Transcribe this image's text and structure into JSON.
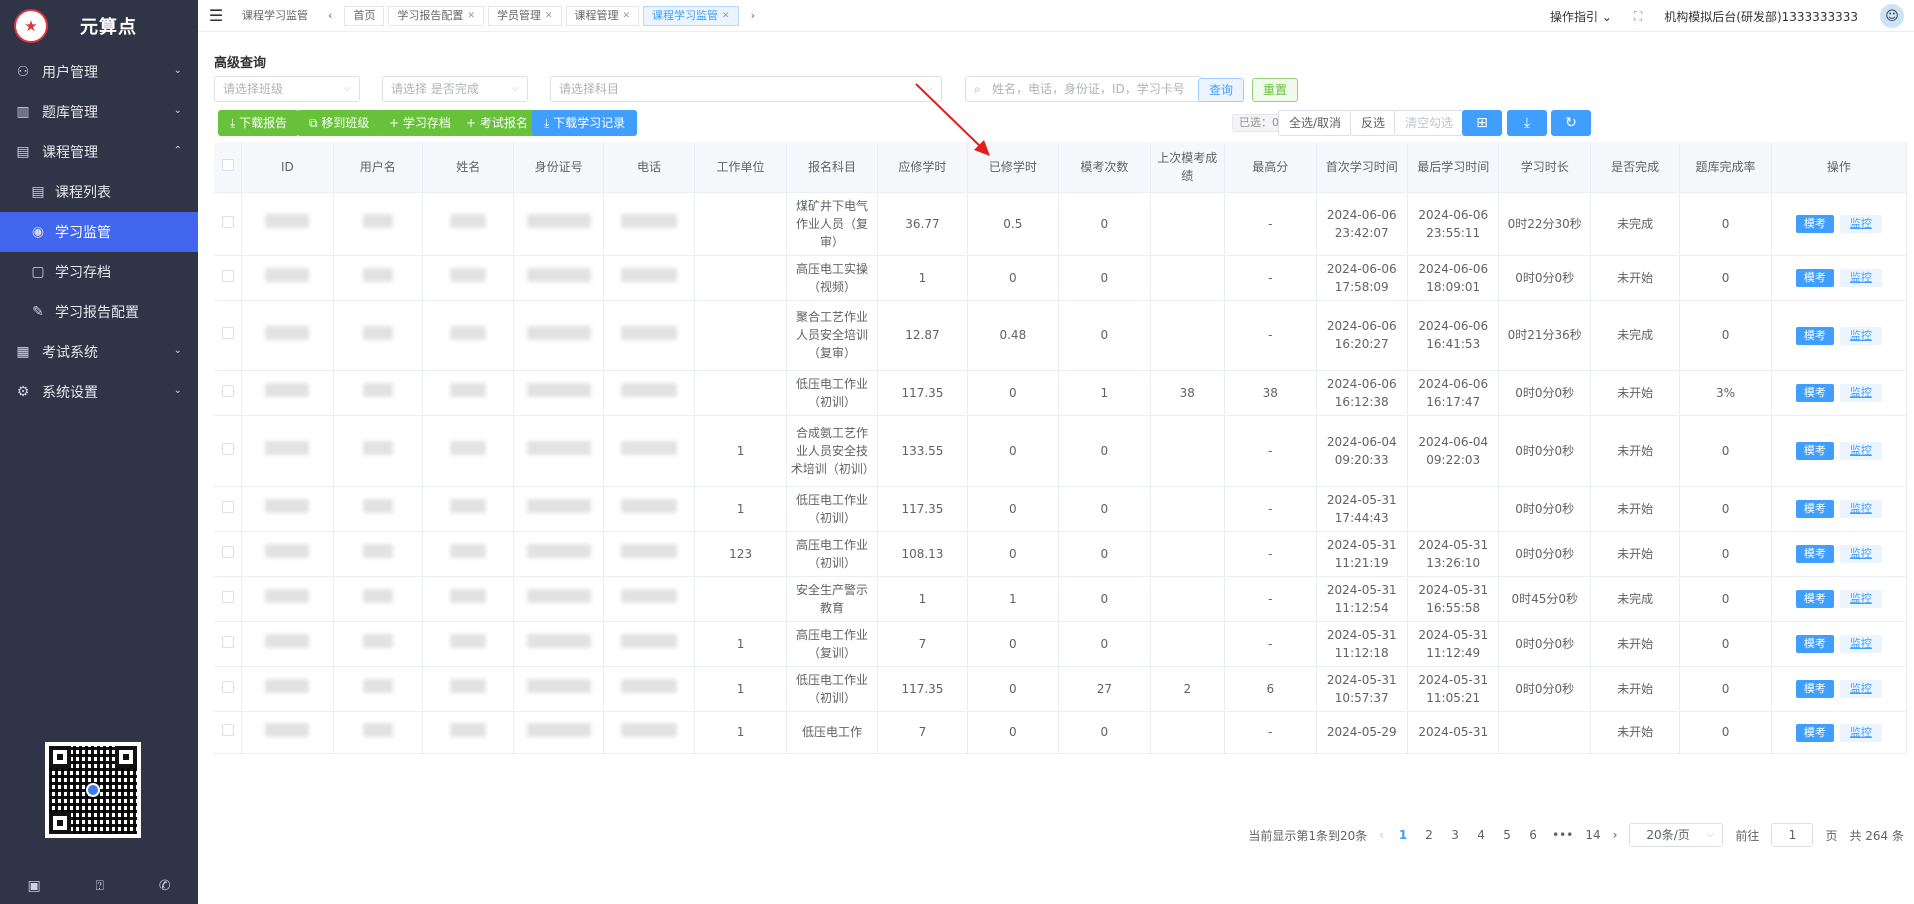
{
  "brand": {
    "name": "元算点",
    "logo_icon": "seal-logo-icon"
  },
  "sidebar": {
    "items": [
      {
        "label": "用户管理",
        "icon": "users-icon",
        "expanded": false
      },
      {
        "label": "题库管理",
        "icon": "library-icon",
        "expanded": false
      },
      {
        "label": "课程管理",
        "icon": "book-icon",
        "expanded": true
      },
      {
        "label": "考试系统",
        "icon": "exam-icon",
        "expanded": false
      },
      {
        "label": "系统设置",
        "icon": "gear-icon",
        "expanded": false
      }
    ],
    "sub_items": [
      {
        "label": "课程列表",
        "icon": "list-icon"
      },
      {
        "label": "学习监管",
        "icon": "eye-icon",
        "active": true
      },
      {
        "label": "学习存档",
        "icon": "file-icon"
      },
      {
        "label": "学习报告配置",
        "icon": "edit-icon"
      }
    ]
  },
  "topbar": {
    "tabs": [
      {
        "label": "课程学习监管",
        "closable": false,
        "plain": true
      },
      {
        "label": "首页",
        "closable": false
      },
      {
        "label": "学习报告配置",
        "closable": true
      },
      {
        "label": "学员管理",
        "closable": true
      },
      {
        "label": "课程管理",
        "closable": true
      },
      {
        "label": "课程学习监管",
        "closable": true,
        "active": true
      }
    ],
    "guide": "操作指引",
    "user": "机构模拟后台(研发部)1333333333"
  },
  "filters": {
    "title": "高级查询",
    "class_placeholder": "请选择班级",
    "done_placeholder": "请选择 是否完成",
    "subject_placeholder": "请选择科目",
    "search_placeholder": "姓名，电话，身份证，ID，学习卡号",
    "query_label": "查询",
    "reset_label": "重置"
  },
  "toolbar": {
    "download_report": "下载报告",
    "move_class": "移到班级",
    "archive": "学习存档",
    "exam_signup": "考试报名",
    "download_record": "下载学习记录",
    "selected": "已选：0",
    "select_all": "全选/取消",
    "invert": "反选",
    "clear": "清空勾选"
  },
  "table": {
    "headers": [
      "ID",
      "用户名",
      "姓名",
      "身份证号",
      "电话",
      "工作单位",
      "报名科目",
      "应修学时",
      "已修学时",
      "模考次数",
      "上次模考成绩",
      "最高分",
      "首次学习时间",
      "最后学习时间",
      "学习时长",
      "是否完成",
      "题库完成率",
      "操作"
    ],
    "op_primary": "模考",
    "op_link": "监控",
    "rows": [
      {
        "unit": "",
        "subject": "煤矿井下电气作业人员（复审）",
        "req": "36.77",
        "done": "0.5",
        "mock": "0",
        "last": "",
        "best": "-",
        "first": "2024-06-06 23:42:07",
        "lastStudy": "2024-06-06 23:55:11",
        "dur": "0时22分30秒",
        "status": "未完成",
        "rate": "0",
        "h": 56
      },
      {
        "unit": "",
        "subject": "高压电工实操（视频）",
        "req": "1",
        "done": "0",
        "mock": "0",
        "last": "",
        "best": "-",
        "first": "2024-06-06 17:58:09",
        "lastStudy": "2024-06-06 18:09:01",
        "dur": "0时0分0秒",
        "status": "未开始",
        "rate": "0",
        "h": 42
      },
      {
        "unit": "",
        "subject": "聚合工艺作业人员安全培训（复审）",
        "req": "12.87",
        "done": "0.48",
        "mock": "0",
        "last": "",
        "best": "-",
        "first": "2024-06-06 16:20:27",
        "lastStudy": "2024-06-06 16:41:53",
        "dur": "0时21分36秒",
        "status": "未完成",
        "rate": "0",
        "h": 70
      },
      {
        "unit": "",
        "subject": "低压电工作业（初训）",
        "req": "117.35",
        "done": "0",
        "mock": "1",
        "last": "38",
        "best": "38",
        "first": "2024-06-06 16:12:38",
        "lastStudy": "2024-06-06 16:17:47",
        "dur": "0时0分0秒",
        "status": "未开始",
        "rate": "3%",
        "h": 42
      },
      {
        "unit": "1",
        "subject": "合成氨工艺作业人员安全技术培训（初训）",
        "req": "133.55",
        "done": "0",
        "mock": "0",
        "last": "",
        "best": "-",
        "first": "2024-06-04 09:20:33",
        "lastStudy": "2024-06-04 09:22:03",
        "dur": "0时0分0秒",
        "status": "未开始",
        "rate": "0",
        "h": 71
      },
      {
        "unit": "1",
        "subject": "低压电工作业（初训）",
        "req": "117.35",
        "done": "0",
        "mock": "0",
        "last": "",
        "best": "-",
        "first": "2024-05-31 17:44:43",
        "lastStudy": "",
        "dur": "0时0分0秒",
        "status": "未开始",
        "rate": "0",
        "h": 42
      },
      {
        "unit": "123",
        "subject": "高压电工作业（初训）",
        "req": "108.13",
        "done": "0",
        "mock": "0",
        "last": "",
        "best": "-",
        "first": "2024-05-31 11:21:19",
        "lastStudy": "2024-05-31 13:26:10",
        "dur": "0时0分0秒",
        "status": "未开始",
        "rate": "0",
        "h": 41
      },
      {
        "unit": "",
        "subject": "安全生产警示教育",
        "req": "1",
        "done": "1",
        "mock": "0",
        "last": "",
        "best": "-",
        "first": "2024-05-31 11:12:54",
        "lastStudy": "2024-05-31 16:55:58",
        "dur": "0时45分0秒",
        "status": "未完成",
        "rate": "0",
        "h": 42
      },
      {
        "unit": "1",
        "subject": "高压电工作业（复训）",
        "req": "7",
        "done": "0",
        "mock": "0",
        "last": "",
        "best": "-",
        "first": "2024-05-31 11:12:18",
        "lastStudy": "2024-05-31 11:12:49",
        "dur": "0时0分0秒",
        "status": "未开始",
        "rate": "0",
        "h": 41
      },
      {
        "unit": "1",
        "subject": "低压电工作业（初训）",
        "req": "117.35",
        "done": "0",
        "mock": "27",
        "last": "2",
        "best": "6",
        "first": "2024-05-31 10:57:37",
        "lastStudy": "2024-05-31 11:05:21",
        "dur": "0时0分0秒",
        "status": "未开始",
        "rate": "0",
        "h": 42
      },
      {
        "unit": "1",
        "subject": "低压电工作",
        "req": "7",
        "done": "0",
        "mock": "0",
        "last": "",
        "best": "-",
        "first": "2024-05-29",
        "lastStudy": "2024-05-31",
        "dur": "",
        "status": "未开始",
        "rate": "0",
        "h": 42
      }
    ]
  },
  "pagination": {
    "summary": "当前显示第1条到20条",
    "pages": [
      "1",
      "2",
      "3",
      "4",
      "5",
      "6",
      "•••",
      "14"
    ],
    "current": "1",
    "page_size": "20条/页",
    "goto_label": "前往",
    "goto_value": "1",
    "page_unit": "页",
    "total": "共 264 条"
  }
}
